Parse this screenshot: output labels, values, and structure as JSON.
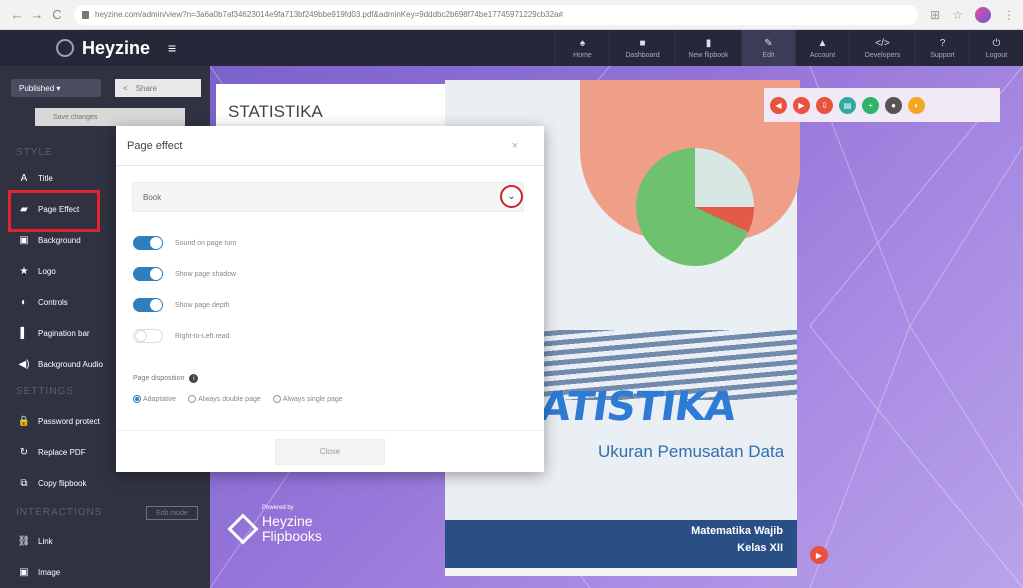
{
  "browser": {
    "url": "heyzine.com/admin/view?n=3a6a0b7af34623014e9fa713bf249bbe919fd03.pdf&adminKey=9dddbc2b698f74be17745971229cb32a#",
    "nav_back": "←",
    "nav_forward": "→",
    "nav_reload": "C"
  },
  "app": {
    "logo": "Heyzine",
    "menu_icon": "≡"
  },
  "topnav": [
    {
      "label": "Home",
      "icon": "home-icon",
      "glyph": "♠"
    },
    {
      "label": "Dashboard",
      "icon": "dashboard-icon",
      "glyph": "■"
    },
    {
      "label": "New flipbook",
      "icon": "new-flipbook-icon",
      "glyph": "▮"
    },
    {
      "label": "Edit",
      "icon": "edit-icon",
      "glyph": "✎"
    },
    {
      "label": "Account",
      "icon": "account-icon",
      "glyph": "▲"
    },
    {
      "label": "Developers",
      "icon": "code-icon",
      "glyph": "</>"
    },
    {
      "label": "Support",
      "icon": "support-icon",
      "glyph": "?"
    },
    {
      "label": "Logout",
      "icon": "power-icon",
      "glyph": "⏻"
    }
  ],
  "sidebar": {
    "published": "Published ▾",
    "share": "Share",
    "save": "Save changes",
    "section_style": "STYLE",
    "section_settings": "SETTINGS",
    "section_interactions": "INTERACTIONS",
    "edit_mode": "Edit mode",
    "style_items": [
      {
        "label": "Title",
        "glyph": "A"
      },
      {
        "label": "Page Effect",
        "glyph": "▰"
      },
      {
        "label": "Background",
        "glyph": "▣"
      },
      {
        "label": "Logo",
        "glyph": "★"
      },
      {
        "label": "Controls",
        "glyph": "◐"
      },
      {
        "label": "Pagination bar",
        "glyph": "▌"
      },
      {
        "label": "Background Audio",
        "glyph": "◀)"
      }
    ],
    "settings_items": [
      {
        "label": "Password protect",
        "glyph": "🔒"
      },
      {
        "label": "Replace PDF",
        "glyph": "↻"
      },
      {
        "label": "Copy flipbook",
        "glyph": "⧉"
      }
    ],
    "interaction_items": [
      {
        "label": "Link",
        "glyph": "⛓"
      },
      {
        "label": "Image",
        "glyph": "▣"
      }
    ]
  },
  "preview": {
    "stat_title": "STATISTIKA",
    "powered_by": "Powered by",
    "brand_line1": "Heyzine",
    "brand_line2": "Flipbooks",
    "book_title": "ATISTIKA",
    "book_subtitle": "Ukuran Pemusatan Data",
    "book_line1": "Matematika Wajib",
    "book_line2": "Kelas XII",
    "next_glyph": "▶"
  },
  "toolbar_buttons": [
    {
      "icon": "prev-icon",
      "color": "#e8523f",
      "glyph": "◀"
    },
    {
      "icon": "next-icon",
      "color": "#e8523f",
      "glyph": "▶"
    },
    {
      "icon": "download-icon",
      "color": "#e8523f",
      "glyph": "⇩"
    },
    {
      "icon": "print-icon",
      "color": "#34a8a0",
      "glyph": "▤"
    },
    {
      "icon": "zoom-icon",
      "color": "#2fb36b",
      "glyph": "+"
    },
    {
      "icon": "fullscreen-icon",
      "color": "#555555",
      "glyph": "●"
    },
    {
      "icon": "sound-icon",
      "color": "#f5a623",
      "glyph": "◐"
    }
  ],
  "modal": {
    "title": "Page effect",
    "close_x": "×",
    "select_value": "Book",
    "chevron": "⌄",
    "toggles": [
      {
        "label": "Sound on page turn",
        "on": true
      },
      {
        "label": "Show page shadow",
        "on": true
      },
      {
        "label": "Show page depth",
        "on": true
      },
      {
        "label": "Right-to-Left read",
        "on": false
      }
    ],
    "disposition_label": "Page disposition",
    "info_glyph": "i",
    "radios": [
      {
        "label": "Adaptative",
        "selected": true
      },
      {
        "label": "Always double page",
        "selected": false
      },
      {
        "label": "Always single page",
        "selected": false
      }
    ],
    "close_button": "Close"
  },
  "colors": {
    "accent_blue": "#2f7fbf",
    "highlight_red": "#e3232f",
    "sidebar_bg": "#303241",
    "header_bg": "#26283a"
  }
}
